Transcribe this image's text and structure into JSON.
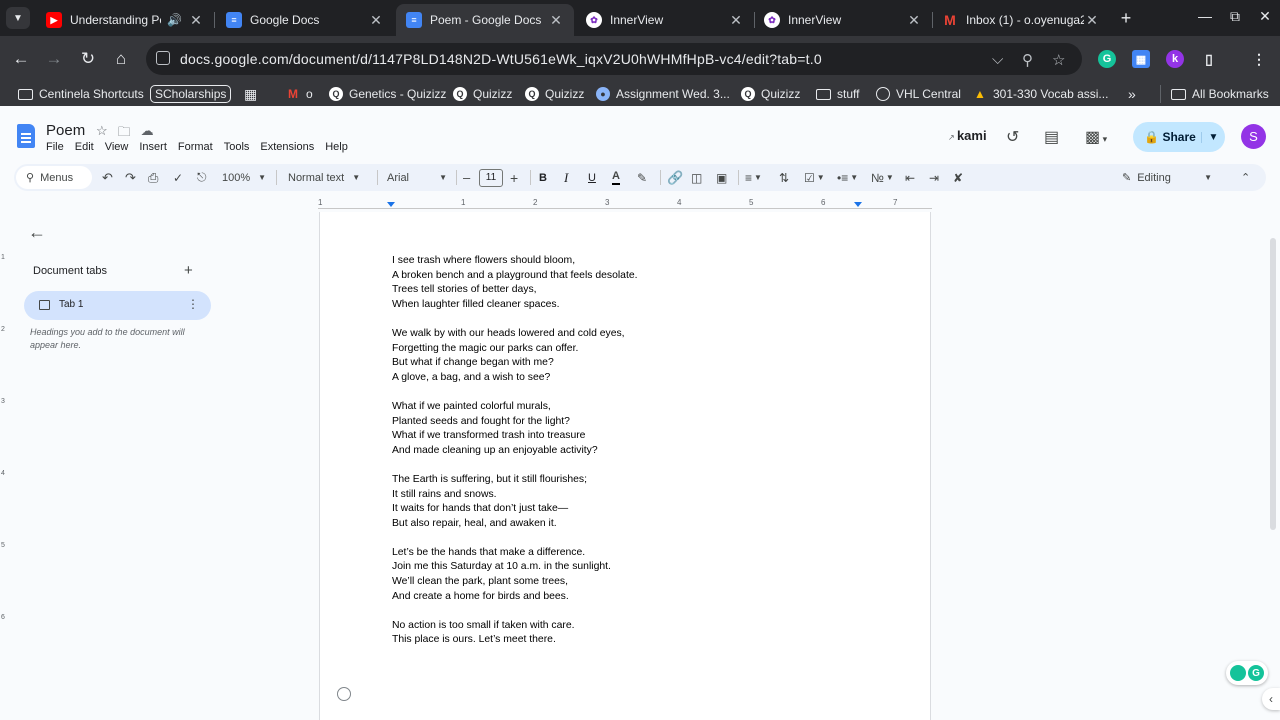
{
  "browser": {
    "tabs": [
      {
        "title": "Understanding Pe",
        "favicon": "youtube-icon",
        "color": "#ff0000",
        "audio": true
      },
      {
        "title": "Google Docs",
        "favicon": "docs-icon",
        "color": "#4285f4"
      },
      {
        "title": "Poem - Google Docs",
        "favicon": "docs-icon",
        "color": "#4285f4",
        "active": true
      },
      {
        "title": "InnerView",
        "favicon": "innerview-icon",
        "color": "#7b2cbf"
      },
      {
        "title": "InnerView",
        "favicon": "innerview-icon",
        "color": "#7b2cbf"
      },
      {
        "title": "Inbox (1) - o.oyenuga2",
        "favicon": "gmail-icon",
        "color": "#ea4335"
      }
    ],
    "url": "docs.google.com/document/d/1147P8LD148N2D-WtU561eWk_iqxV2U0hWHMfHpB-vc4/edit?tab=t.0",
    "bookmarks": [
      {
        "label": "Centinela Shortcuts",
        "icon": "folder-icon"
      },
      {
        "label": "SCholarships",
        "icon": "none"
      },
      {
        "label": "",
        "icon": "apps-grid-icon"
      },
      {
        "label": "o",
        "icon": "gmail-icon"
      },
      {
        "label": "Genetics - Quizizz",
        "icon": "quizizz-icon"
      },
      {
        "label": "Quizizz",
        "icon": "quizizz-icon"
      },
      {
        "label": "Quizizz",
        "icon": "quizizz-icon"
      },
      {
        "label": "Assignment Wed. 3...",
        "icon": "assignment-icon"
      },
      {
        "label": "Quizizz",
        "icon": "quizizz-icon"
      },
      {
        "label": "stuff",
        "icon": "folder-icon"
      },
      {
        "label": "VHL Central",
        "icon": "globe-icon"
      },
      {
        "label": "301-330 Vocab assi...",
        "icon": "drive-icon"
      }
    ],
    "all_bookmarks": "All Bookmarks"
  },
  "docs": {
    "title": "Poem",
    "menu": [
      "File",
      "Edit",
      "View",
      "Insert",
      "Format",
      "Tools",
      "Extensions",
      "Help"
    ],
    "kami": "kami",
    "share": "Share",
    "avatar_letter": "S",
    "avatar_color": "#9334e6",
    "toolbar": {
      "search": "Menus",
      "zoom": "100%",
      "style": "Normal text",
      "font": "Arial",
      "font_size": "11",
      "bold": "B",
      "italic": "I",
      "underline": "U",
      "text_color": "A",
      "mode": "Editing"
    }
  },
  "sidebar": {
    "heading": "Document tabs",
    "tab_label": "Tab 1",
    "hint": "Headings you add to the document will appear here."
  },
  "ruler": {
    "numbers": [
      "1",
      "1",
      "2",
      "3",
      "4",
      "5",
      "6",
      "7"
    ],
    "vertical_numbers": [
      "1",
      "2",
      "3",
      "4",
      "5",
      "6"
    ]
  },
  "poem": {
    "stanzas": [
      [
        "I see trash where flowers should bloom,",
        "A broken bench and a playground that feels desolate.",
        "Trees tell stories of better days,",
        "When laughter filled cleaner spaces."
      ],
      [
        "We walk by with our heads lowered and cold eyes,",
        "Forgetting the magic our parks can offer.",
        "But what if change began with me?",
        "A glove, a bag, and a wish to see?"
      ],
      [
        "What if we painted colorful murals,",
        "Planted seeds and fought for the light?",
        "What if we transformed trash into treasure",
        "And made cleaning up an enjoyable activity?"
      ],
      [
        "The Earth is suffering, but it still flourishes;",
        "It still rains and snows.",
        "It waits for hands that don’t just take—",
        "But also repair, heal, and awaken it."
      ],
      [
        "Let’s be the hands that make a difference.",
        "Join me this Saturday at 10 a.m. in the sunlight.",
        "We’ll clean the park, plant some trees,",
        "And create a home for birds and bees."
      ],
      [
        "No action is too small if taken with care.",
        "This place is ours. Let’s meet there."
      ]
    ]
  }
}
